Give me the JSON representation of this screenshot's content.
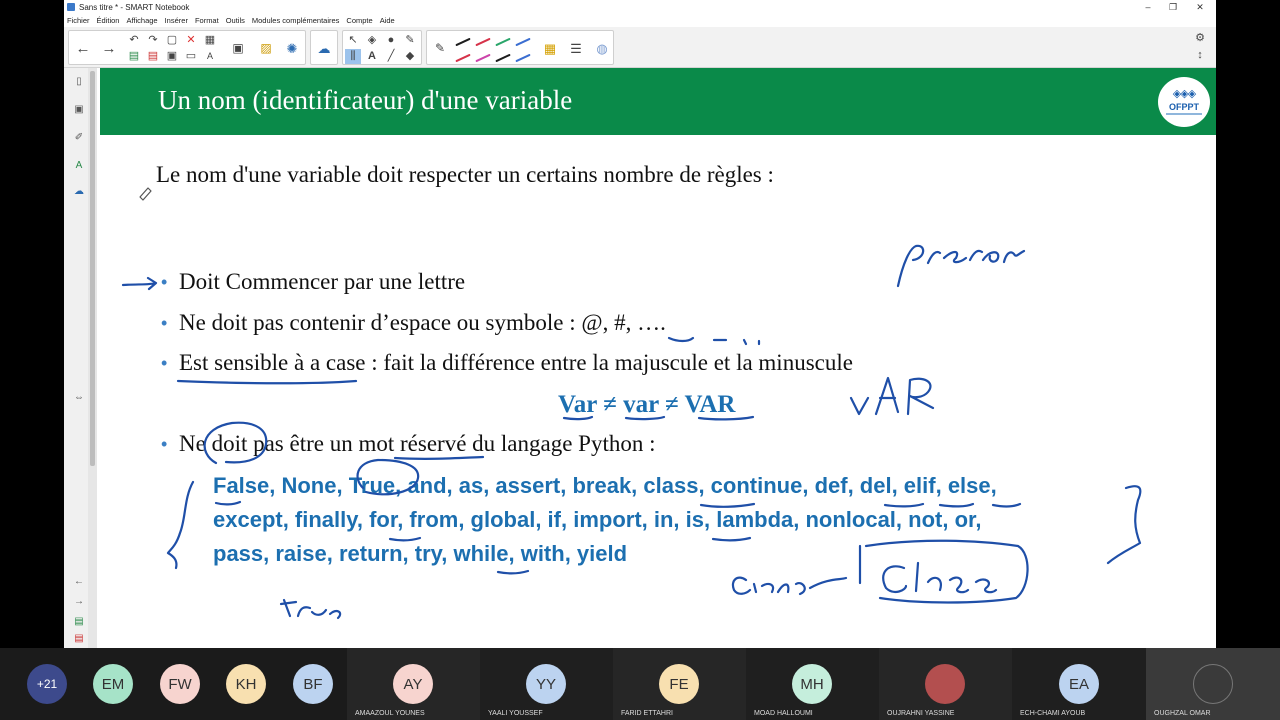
{
  "window": {
    "title": "Sans titre * - SMART Notebook",
    "controls": [
      "–",
      "❐",
      "✕"
    ]
  },
  "menu": [
    "Fichier",
    "Édition",
    "Affichage",
    "Insérer",
    "Format",
    "Outils",
    "Modules complémentaires",
    "Compte",
    "Aide"
  ],
  "toolbar": {
    "pen_colors": [
      "#1d1d1d",
      "#d6334a",
      "#2aa66a",
      "#3b6ed1",
      "#d6334a",
      "#cc44aa",
      "#1d1d1d",
      "#3b6ed1"
    ]
  },
  "slide": {
    "title": "Un nom (identificateur) d'une variable",
    "logo_text": "OFPPT",
    "intro": "Le nom d'une variable doit respecter un certains nombre de règles :",
    "bullets": [
      "Doit Commencer par une lettre",
      "Ne doit pas contenir d’espace ou symbole : @, #, ….",
      "Est sensible à a case : fait la différence entre la majuscule et la minuscule",
      "Ne doit pas être un mot réservé du langage Python :"
    ],
    "var_example": "Var ≠ var ≠ VAR",
    "keywords_lines": [
      "False, None, True, and, as, assert, break, class, continue, def, del, elif, else,",
      "except, finally, for, from, global, if, import, in, is, lambda, nonlocal, not, or,",
      "pass, raise, return, try, while, with, yield"
    ],
    "colors": {
      "header": "#0a8a49",
      "keyword": "#1c6fb0",
      "ink": "#1f4fa8"
    }
  },
  "participants": [
    {
      "initials": "+21",
      "name": "",
      "color": "#3d4a8c"
    },
    {
      "initials": "EM",
      "name": "",
      "color": "#a6e3c8"
    },
    {
      "initials": "FW",
      "name": "",
      "color": "#f7d4cf"
    },
    {
      "initials": "KH",
      "name": "",
      "color": "#f8e0b0"
    },
    {
      "initials": "BF",
      "name": "",
      "color": "#bcd3f0"
    },
    {
      "initials": "AY",
      "name": "AMAAZOUL YOUNES",
      "color": "#f7d4cf"
    },
    {
      "initials": "YY",
      "name": "YAALI YOUSSEF",
      "color": "#bcd3f0"
    },
    {
      "initials": "FE",
      "name": "FARID ETTAHRI",
      "color": "#f8e0b0"
    },
    {
      "initials": "MH",
      "name": "MOAD HALLOUMI",
      "color": "#c5eedc"
    },
    {
      "initials": "",
      "name": "OUJRAHNI YASSINE",
      "color": "#b34f4f"
    },
    {
      "initials": "EA",
      "name": "ECH-CHAMI AYOUB",
      "color": "#bcd3f0"
    },
    {
      "initials": "",
      "name": "OUGHZAL OMAR",
      "color": "#3a3a3a"
    }
  ]
}
